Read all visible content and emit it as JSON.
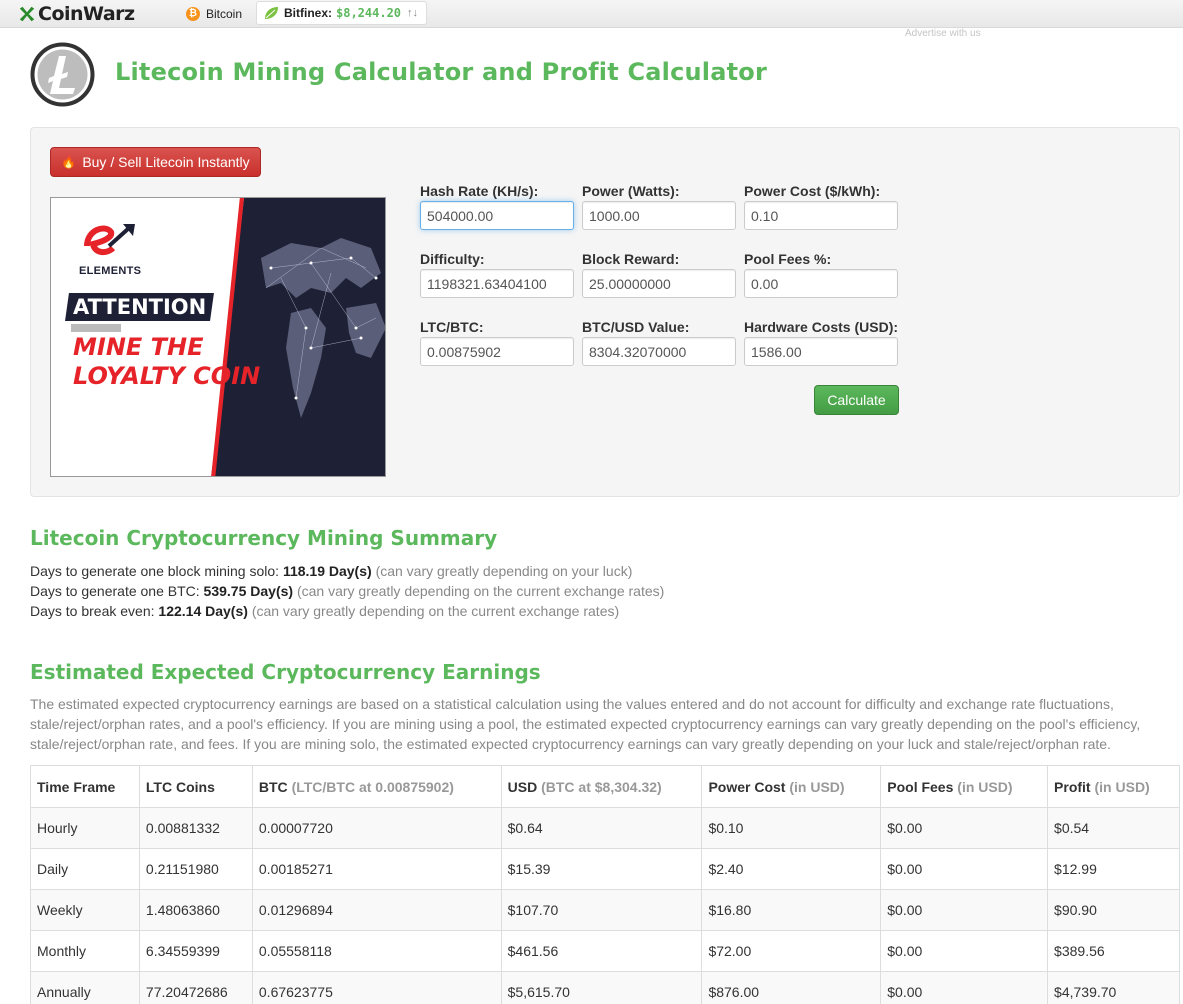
{
  "topbar": {
    "brand": "CoinWarz",
    "bitcoin_label": "Bitcoin",
    "ticker_label": "Bitfinex:",
    "ticker_price": "$8,244.20",
    "ticker_arrows": "↑↓",
    "advertise": "Advertise with us"
  },
  "header": {
    "title": "Litecoin Mining Calculator and Profit Calculator"
  },
  "calculator": {
    "buy_button": "Buy / Sell Litecoin Instantly",
    "calculate_button": "Calculate",
    "fields": {
      "hash_rate": {
        "label": "Hash Rate (KH/s):",
        "value": "504000.00"
      },
      "power": {
        "label": "Power (Watts):",
        "value": "1000.00"
      },
      "power_cost": {
        "label": "Power Cost ($/kWh):",
        "value": "0.10"
      },
      "difficulty": {
        "label": "Difficulty:",
        "value": "1198321.63404100"
      },
      "block_reward": {
        "label": "Block Reward:",
        "value": "25.00000000"
      },
      "pool_fees": {
        "label": "Pool Fees %:",
        "value": "0.00"
      },
      "ltc_btc": {
        "label": "LTC/BTC:",
        "value": "0.00875902"
      },
      "btc_usd": {
        "label": "BTC/USD Value:",
        "value": "8304.32070000"
      },
      "hardware_costs": {
        "label": "Hardware Costs (USD):",
        "value": "1586.00"
      }
    }
  },
  "ad": {
    "brand": "ELEMENTS",
    "attention": "ATTENTION",
    "headline": "MINE THE LOYALTY COIN"
  },
  "summary": {
    "title": "Litecoin Cryptocurrency Mining Summary",
    "lines": [
      {
        "prefix": "Days to generate one block mining solo:",
        "value": "118.19 Day(s)",
        "note": "(can vary greatly depending on your luck)"
      },
      {
        "prefix": "Days to generate one BTC:",
        "value": "539.75 Day(s)",
        "note": "(can vary greatly depending on the current exchange rates)"
      },
      {
        "prefix": "Days to break even:",
        "value": "122.14 Day(s)",
        "note": "(can vary greatly depending on the current exchange rates)"
      }
    ]
  },
  "earnings": {
    "title": "Estimated Expected Cryptocurrency Earnings",
    "description": "The estimated expected cryptocurrency earnings are based on a statistical calculation using the values entered and do not account for difficulty and exchange rate fluctuations, stale/reject/orphan rates, and a pool's efficiency. If you are mining using a pool, the estimated expected cryptocurrency earnings can vary greatly depending on the pool's efficiency, stale/reject/orphan rate, and fees. If you are mining solo, the estimated expected cryptocurrency earnings can vary greatly depending on your luck and stale/reject/orphan rate.",
    "headers": [
      {
        "main": "Time Frame",
        "sub": ""
      },
      {
        "main": "LTC Coins",
        "sub": ""
      },
      {
        "main": "BTC",
        "sub": "(LTC/BTC at 0.00875902)"
      },
      {
        "main": "USD",
        "sub": "(BTC at $8,304.32)"
      },
      {
        "main": "Power Cost",
        "sub": "(in USD)"
      },
      {
        "main": "Pool Fees",
        "sub": "(in USD)"
      },
      {
        "main": "Profit",
        "sub": "(in USD)"
      }
    ],
    "rows": [
      [
        "Hourly",
        "0.00881332",
        "0.00007720",
        "$0.64",
        "$0.10",
        "$0.00",
        "$0.54"
      ],
      [
        "Daily",
        "0.21151980",
        "0.00185271",
        "$15.39",
        "$2.40",
        "$0.00",
        "$12.99"
      ],
      [
        "Weekly",
        "1.48063860",
        "0.01296894",
        "$107.70",
        "$16.80",
        "$0.00",
        "$90.90"
      ],
      [
        "Monthly",
        "6.34559399",
        "0.05558118",
        "$461.56",
        "$72.00",
        "$0.00",
        "$389.56"
      ],
      [
        "Annually",
        "77.20472686",
        "0.67623775",
        "$5,615.70",
        "$876.00",
        "$0.00",
        "$4,739.70"
      ]
    ]
  },
  "colors": {
    "accent_green": "#5cb85c",
    "buy_red": "#d9534f",
    "ad_navy": "#1e2035",
    "ad_red": "#e52329"
  }
}
